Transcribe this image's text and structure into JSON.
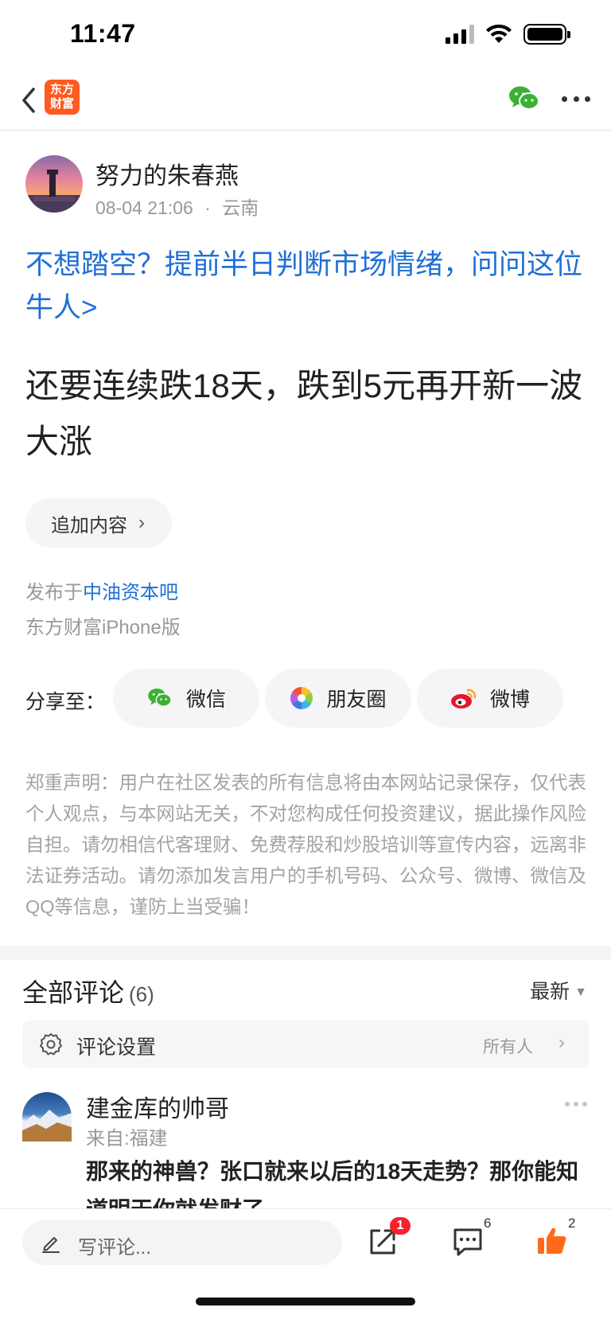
{
  "status_bar": {
    "time": "11:47"
  },
  "nav": {
    "logo_text": "东方财富"
  },
  "author": {
    "name": "努力的朱春燕",
    "datetime": "08-04 21:06",
    "separator": "·",
    "location": "云南"
  },
  "post": {
    "promo_link": "不想踏空？提前半日判断市场情绪，问问这位牛人>",
    "title": "还要连续跌18天，跌到5元再开新一波大涨",
    "append_label": "追加内容",
    "posted_in_prefix": "发布于",
    "forum_name": "中油资本吧",
    "client": "东方财富iPhone版"
  },
  "share": {
    "label": "分享至：",
    "targets": [
      {
        "label": "微信",
        "icon": "wechat-icon"
      },
      {
        "label": "朋友圈",
        "icon": "moments-icon"
      },
      {
        "label": "微博",
        "icon": "weibo-icon"
      }
    ]
  },
  "disclaimer": "郑重声明：用户在社区发表的所有信息将由本网站记录保存，仅代表个人观点，与本网站无关，不对您构成任何投资建议，据此操作风险自担。请勿相信代客理财、免费荐股和炒股培训等宣传内容，远离非法证券活动。请勿添加发言用户的手机号码、公众号、微博、微信及QQ等信息，谨防上当受骗！",
  "comments": {
    "title": "全部评论",
    "count": "(6)",
    "sort": "最新",
    "settings_label": "评论设置",
    "settings_value": "所有人",
    "items": [
      {
        "name": "建金库的帅哥",
        "from": "来自:福建",
        "text": "那来的神兽？张口就来以后的18天走势？那你能知道明天你就发财了"
      }
    ]
  },
  "bottom_bar": {
    "write_placeholder": "写评论...",
    "share_badge": "1",
    "comment_count": "6",
    "like_count": "2"
  },
  "colors": {
    "link_blue": "#1f6fd6",
    "brand_orange": "#ff5a1f",
    "badge_red": "#f5222d",
    "wechat_green": "#3cb034"
  }
}
